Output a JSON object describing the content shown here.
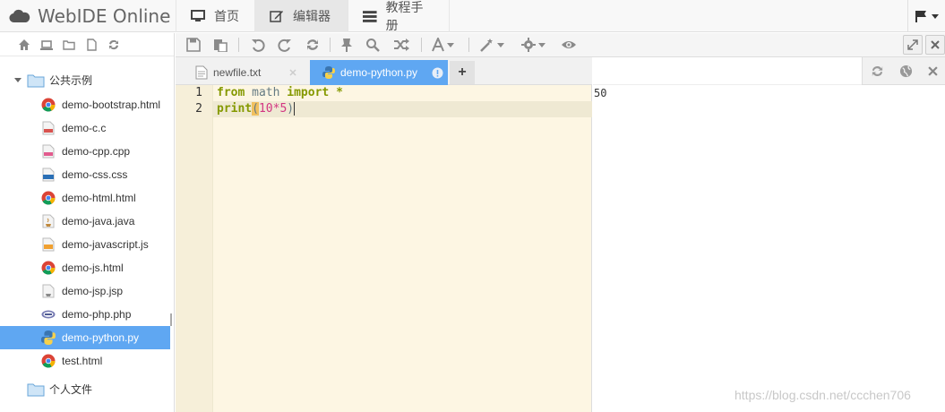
{
  "brand": {
    "title": "WebIDE Online"
  },
  "nav": {
    "home": "首页",
    "editor": "编辑器",
    "manual": "教程手册"
  },
  "tree": {
    "public_folder": "公共示例",
    "private_folder": "个人文件",
    "files": [
      {
        "name": "demo-bootstrap.html",
        "icon": "chrome-icon"
      },
      {
        "name": "demo-c.c",
        "icon": "c-file-icon"
      },
      {
        "name": "demo-cpp.cpp",
        "icon": "cpp-file-icon"
      },
      {
        "name": "demo-css.css",
        "icon": "css-file-icon"
      },
      {
        "name": "demo-html.html",
        "icon": "chrome-icon"
      },
      {
        "name": "demo-java.java",
        "icon": "java-file-icon"
      },
      {
        "name": "demo-javascript.js",
        "icon": "js-file-icon"
      },
      {
        "name": "demo-js.html",
        "icon": "chrome-icon"
      },
      {
        "name": "demo-jsp.jsp",
        "icon": "jsp-file-icon"
      },
      {
        "name": "demo-php.php",
        "icon": "php-file-icon"
      },
      {
        "name": "demo-python.py",
        "icon": "python-icon",
        "selected": true
      },
      {
        "name": "test.html",
        "icon": "chrome-icon"
      }
    ]
  },
  "editor_tabs": {
    "tab1": "newfile.txt",
    "tab2": "demo-python.py",
    "add": "+"
  },
  "code": {
    "line_numbers": [
      "1",
      "2"
    ],
    "l1_kw1": "from",
    "l1_mod": " math ",
    "l1_kw2": "import",
    "l1_star": " *",
    "l2_fn": "print",
    "l2_open": "(",
    "l2_n1": "10",
    "l2_op": "*",
    "l2_n2": "5",
    "l2_close": ")"
  },
  "output": {
    "text": "50"
  },
  "watermark": "https://blog.csdn.net/ccchen706",
  "colors": {
    "accent": "#5fa7f2",
    "editor_bg": "#fdf6e3",
    "keyword": "#859900",
    "number": "#d33682"
  }
}
